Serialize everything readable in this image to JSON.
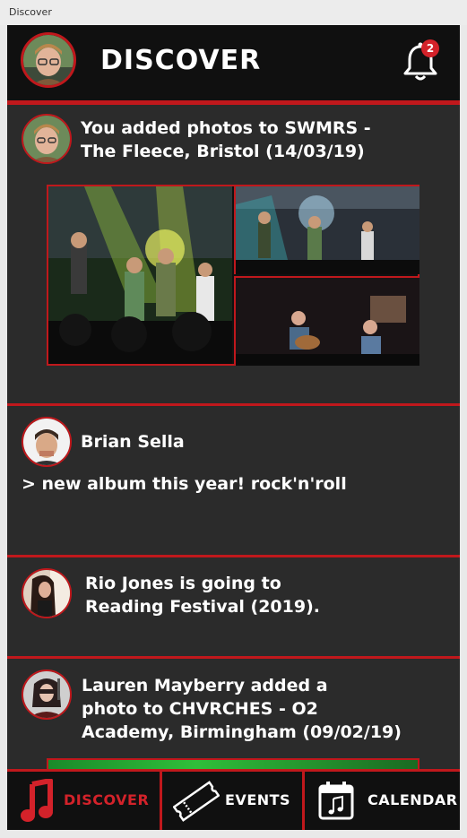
{
  "window": {
    "title": "Discover"
  },
  "header": {
    "title": "DISCOVER",
    "notification_count": "2"
  },
  "feed": [
    {
      "text_line1": "You added photos to SWMRS -",
      "text_line2": "The Fleece, Bristol (14/03/19)"
    },
    {
      "name": "Brian Sella",
      "message": "> new album this year! rock'n'roll"
    },
    {
      "text_line1": "Rio Jones is going to",
      "text_line2": "Reading Festival (2019)."
    },
    {
      "text_line1": "Lauren Mayberry added a",
      "text_line2": "photo to CHVRCHES - O2",
      "text_line3": "Academy, Birmingham (09/02/19)"
    }
  ],
  "nav": [
    {
      "label": "DISCOVER",
      "icon": "music-note-icon",
      "active": true
    },
    {
      "label": "EVENTS",
      "icon": "ticket-icon",
      "active": false
    },
    {
      "label": "CALENDAR",
      "icon": "calendar-icon",
      "active": false
    }
  ],
  "colors": {
    "accent": "#c0181c",
    "background": "#2b2b2b",
    "header": "#101010",
    "text": "#ffffff"
  }
}
